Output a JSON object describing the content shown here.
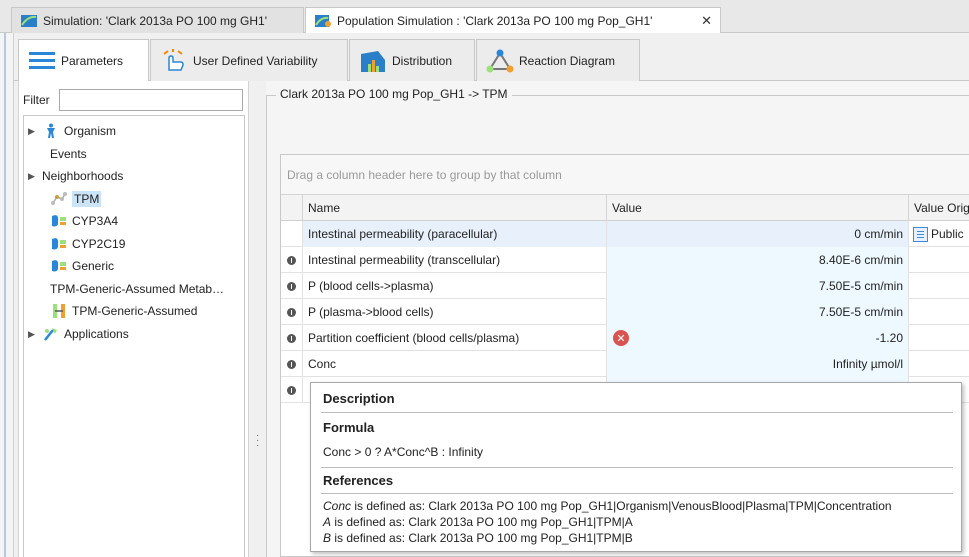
{
  "doc_tabs": [
    {
      "label": "Simulation: 'Clark 2013a PO 100 mg GH1'"
    },
    {
      "label": "Population Simulation : 'Clark 2013a PO 100 mg Pop_GH1'"
    }
  ],
  "sub_tabs": [
    {
      "label": "Parameters",
      "icon": "parameters-icon"
    },
    {
      "label": "User Defined Variability",
      "icon": "hand-variability-icon"
    },
    {
      "label": "Distribution",
      "icon": "distribution-icon"
    },
    {
      "label": "Reaction Diagram",
      "icon": "reaction-diagram-icon"
    }
  ],
  "filter": {
    "label": "Filter",
    "value": ""
  },
  "tree": [
    {
      "label": "Organism",
      "expandable": true,
      "icon": "human-icon"
    },
    {
      "label": "Events",
      "expandable": false,
      "icon": ""
    },
    {
      "label": "Neighborhoods",
      "expandable": true,
      "icon": ""
    },
    {
      "label": "TPM",
      "expandable": false,
      "icon": "molecule-icon",
      "selected": true
    },
    {
      "label": "CYP3A4",
      "expandable": false,
      "icon": "enzyme-icon"
    },
    {
      "label": "CYP2C19",
      "expandable": false,
      "icon": "enzyme-icon"
    },
    {
      "label": "Generic",
      "expandable": false,
      "icon": "enzyme-icon"
    },
    {
      "label": "TPM-Generic-Assumed Metab…",
      "expandable": false,
      "icon": ""
    },
    {
      "label": "TPM-Generic-Assumed",
      "expandable": false,
      "icon": "process-icon"
    },
    {
      "label": "Applications",
      "expandable": true,
      "icon": "applications-icon"
    }
  ],
  "path_title": "Clark 2013a PO 100 mg Pop_GH1 -> TPM",
  "grid": {
    "group_hint": "Drag a column header here to group by that column",
    "columns": [
      "Name",
      "Value",
      "Value Orig"
    ],
    "rows": [
      {
        "name": "Intestinal permeability (paracellular)",
        "value": "0 cm/min",
        "origin": "Public",
        "indicator": false,
        "error": false
      },
      {
        "name": "Intestinal permeability (transcellular)",
        "value": "8.40E-6 cm/min",
        "origin": "",
        "indicator": true,
        "error": false
      },
      {
        "name": "P (blood cells->plasma)",
        "value": "7.50E-5 cm/min",
        "origin": "",
        "indicator": true,
        "error": false
      },
      {
        "name": "P (plasma->blood cells)",
        "value": "7.50E-5 cm/min",
        "origin": "",
        "indicator": true,
        "error": false
      },
      {
        "name": "Partition coefficient (blood cells/plasma)",
        "value": "-1.20",
        "origin": "",
        "indicator": true,
        "error": true
      },
      {
        "name": "Conc",
        "value": "Infinity µmol/l",
        "origin": "",
        "indicator": true,
        "error": false
      },
      {
        "name": "",
        "value": "",
        "origin": "",
        "indicator": true,
        "error": false
      }
    ]
  },
  "tooltip": {
    "description_title": "Description",
    "formula_title": "Formula",
    "formula": "Conc > 0 ? A*Conc^B : Infinity",
    "references_title": "References",
    "references": [
      {
        "var": "Conc",
        "text": " is defined as: Clark 2013a PO 100 mg Pop_GH1|Organism|VenousBlood|Plasma|TPM|Concentration"
      },
      {
        "var": "A",
        "text": " is defined as: Clark 2013a PO 100 mg Pop_GH1|TPM|A"
      },
      {
        "var": "B",
        "text": " is defined as: Clark 2013a PO 100 mg Pop_GH1|TPM|B"
      }
    ]
  }
}
